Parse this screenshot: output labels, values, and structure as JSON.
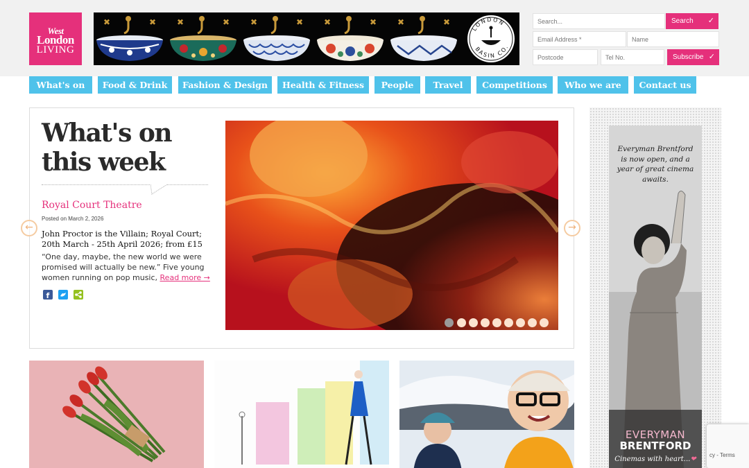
{
  "logo": {
    "line1": "West",
    "line2": "London",
    "line3": "LIVING"
  },
  "banner": {
    "brand_ring_top": "LONDON",
    "brand_ring_bottom": "BASIN CO."
  },
  "header_form": {
    "search_placeholder": "Search...",
    "search_button": "Search",
    "email_placeholder": "Email Address *",
    "name_placeholder": "Name",
    "postcode_placeholder": "Postcode",
    "tel_placeholder": "Tel No.",
    "subscribe_button": "Subscribe",
    "check_icon": "✓"
  },
  "nav": {
    "items": [
      "What's on",
      "Food & Drink",
      "Fashion & Design",
      "Health & Fitness",
      "People",
      "Travel",
      "Competitions",
      "Who we are",
      "Contact us"
    ]
  },
  "feature": {
    "title_line1": "What's on",
    "title_line2": "this week",
    "heading": "Royal Court Theatre",
    "posted": "Posted on March 2, 2026",
    "subtitle": "John Proctor is the Villain; Royal Court; 20th March - 25th April 2026; from £15",
    "excerpt": "“One day, maybe, the new world we were promised will actually be new.” Five young women running on pop music,",
    "read_more": "Read more →",
    "prev_arrow": "←",
    "next_arrow": "→",
    "slide_count": 9,
    "active_slide": 1
  },
  "ad": {
    "text": "Everyman Brentford is now open, and a year of great cinema awaits.",
    "brand_line1": "EVERYMAN",
    "brand_line2": "BRENTFORD",
    "tagline": "Cinemas with heart...",
    "heart": "❤"
  },
  "recaptcha": {
    "text": "cy - Terms"
  },
  "colors": {
    "brand_pink": "#e5307b",
    "nav_blue": "#4fc2ea",
    "header_bg": "#f1f1f1"
  }
}
